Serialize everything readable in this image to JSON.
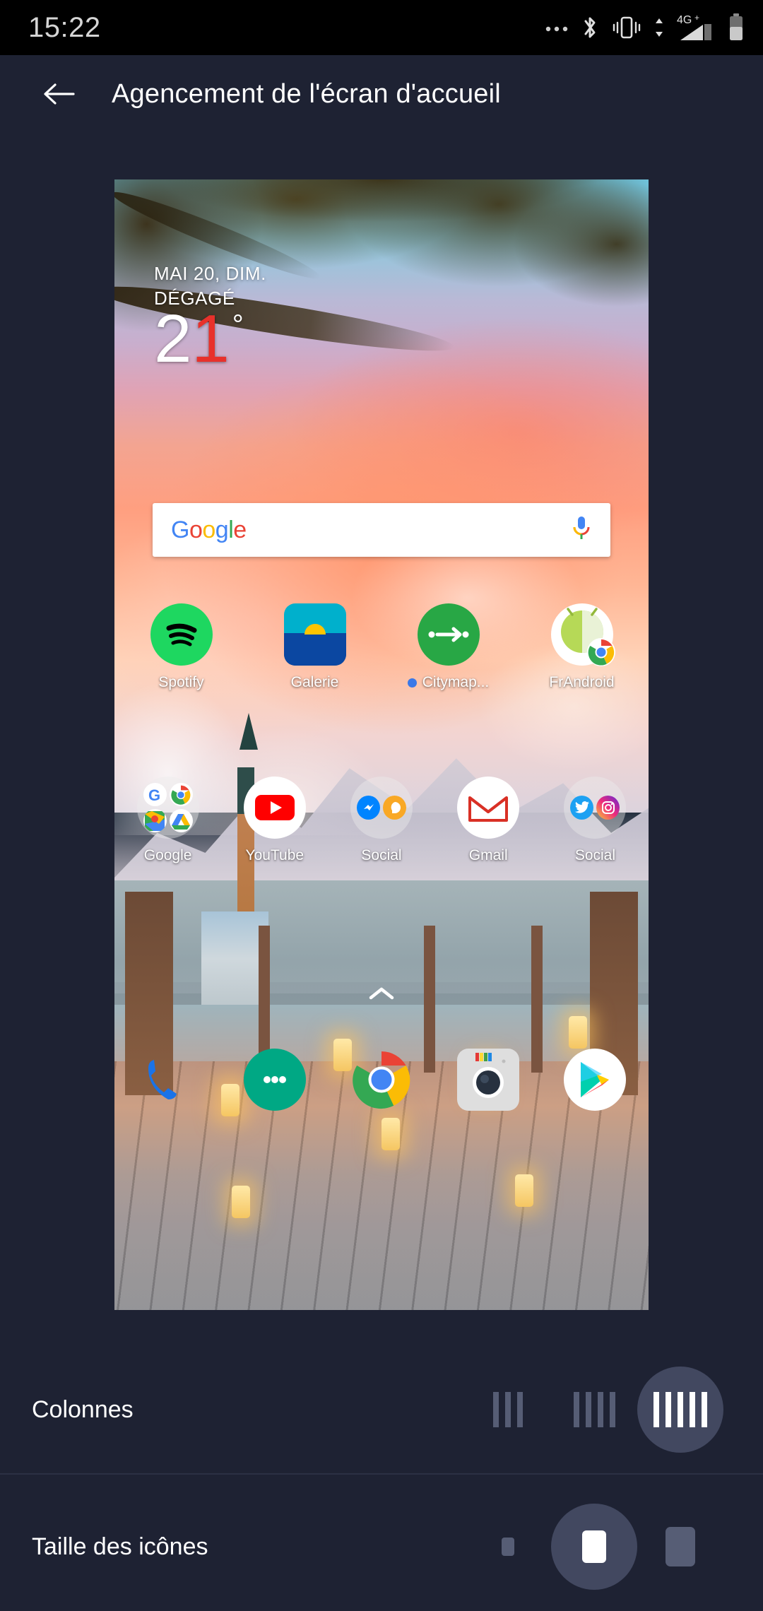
{
  "statusbar": {
    "time": "15:22",
    "icons": [
      "more-notifications-icon",
      "bluetooth-icon",
      "vibrate-icon",
      "data-transfer-icon",
      "signal-4g-plus-icon",
      "battery-icon"
    ],
    "network_label": "4G+"
  },
  "appbar": {
    "back_label": "back-arrow",
    "title": "Agencement de l'écran d'accueil"
  },
  "preview": {
    "weather": {
      "date": "MAI 20, DIM.",
      "condition": "DÉGAGÉ",
      "temp_first": "2",
      "temp_second": "1",
      "degree": "°",
      "accent_color": "#e8312b"
    },
    "search": {
      "logo_g": "G",
      "logo_o1": "o",
      "logo_o2": "o",
      "logo_g2": "g",
      "logo_l": "l",
      "logo_e": "e",
      "mic_label": "microphone-icon"
    },
    "row1": [
      {
        "label": "Spotify",
        "icon": "spotify-icon",
        "dot": false
      },
      {
        "label": "Galerie",
        "icon": "gallery-icon",
        "dot": false
      },
      {
        "label": "Citymap...",
        "icon": "citymapper-icon",
        "dot": true
      },
      {
        "label": "FrAndroid",
        "icon": "frandroid-icon",
        "dot": false
      }
    ],
    "row2": [
      {
        "label": "Google",
        "icon": "google-folder-icon",
        "dot": false
      },
      {
        "label": "YouTube",
        "icon": "youtube-icon",
        "dot": false
      },
      {
        "label": "Social",
        "icon": "social-folder-icon",
        "dot": false
      },
      {
        "label": "Gmail",
        "icon": "gmail-icon",
        "dot": false
      },
      {
        "label": "Social",
        "icon": "social-folder-2-icon",
        "dot": false
      }
    ],
    "drawer_arrow": "chevron-up-icon",
    "dock": [
      {
        "label": "Téléphone",
        "icon": "phone-icon"
      },
      {
        "label": "Messages",
        "icon": "messages-icon"
      },
      {
        "label": "Chrome",
        "icon": "chrome-icon"
      },
      {
        "label": "Appareil photo",
        "icon": "camera-icon"
      },
      {
        "label": "Play Store",
        "icon": "play-store-icon"
      }
    ]
  },
  "settings": [
    {
      "label": "Colonnes",
      "options": [
        {
          "name": "columns-3",
          "bars": 3,
          "selected": false
        },
        {
          "name": "columns-4",
          "bars": 4,
          "selected": false
        },
        {
          "name": "columns-5",
          "bars": 5,
          "selected": true
        }
      ]
    },
    {
      "label": "Taille des icônes",
      "options": [
        {
          "name": "icon-size-small",
          "size": 18,
          "selected": false
        },
        {
          "name": "icon-size-medium",
          "size": 42,
          "selected": true
        },
        {
          "name": "icon-size-large",
          "size": 56,
          "selected": false
        }
      ]
    }
  ],
  "colors": {
    "background": "#1e2233",
    "statusbar_bg": "#000000",
    "selected_pill": "#424860",
    "unselected": "#565d75",
    "divider": "#2b3044",
    "notification_dot": "#3b78e7"
  }
}
